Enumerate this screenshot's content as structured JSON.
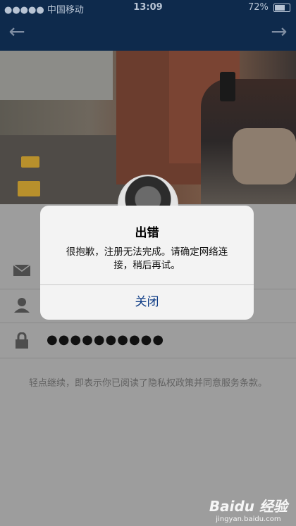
{
  "status_bar": {
    "carrier": "●●●●● 中国移动",
    "time": "13:09",
    "battery": "72%",
    "battery_level": 0.72
  },
  "nav": {
    "back_icon": "arrow-left-icon",
    "forward_icon": "arrow-right-icon"
  },
  "form": {
    "email_icon": "envelope-icon",
    "user_icon": "person-icon",
    "lock_icon": "lock-icon",
    "password_value": "●●●●●●●●●●",
    "terms_text": "轻点继续，即表示你已阅读了隐私权政策并同意服务条款。"
  },
  "dialog": {
    "title": "出错",
    "message": "很抱歉，注册无法完成。请确定网络连接，稍后再试。",
    "close_label": "关闭"
  },
  "watermark": {
    "logo": "Baidu 经验",
    "url": "jingyan.baidu.com"
  }
}
